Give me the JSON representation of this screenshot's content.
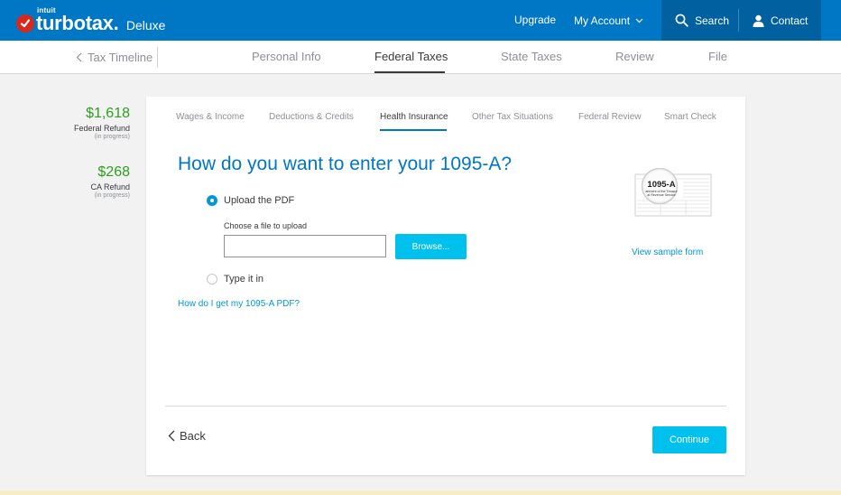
{
  "header": {
    "brand_small": "intuit",
    "brand": "turbotax.",
    "product": "Deluxe",
    "upgrade": "Upgrade",
    "my_account": "My Account",
    "search": "Search",
    "contact": "Contact"
  },
  "section_nav": {
    "timeline": "Tax Timeline",
    "items": [
      "Personal Info",
      "Federal Taxes",
      "State Taxes",
      "Review",
      "File"
    ],
    "active": "Federal Taxes"
  },
  "refunds": [
    {
      "amount": "$1,618",
      "label": "Federal Refund",
      "status": "(in progress)"
    },
    {
      "amount": "$268",
      "label": "CA Refund",
      "status": "(in progress)"
    }
  ],
  "subtabs": {
    "items": [
      "Wages & Income",
      "Deductions & Credits",
      "Health Insurance",
      "Other Tax Situations",
      "Federal Review",
      "Smart Check"
    ],
    "active": "Health Insurance"
  },
  "question": "How do you want to enter your 1095-A?",
  "options": [
    {
      "label": "Upload the PDF",
      "selected": true
    },
    {
      "label": "Type it in",
      "selected": false
    }
  ],
  "upload": {
    "label": "Choose a file to upload",
    "value": "",
    "browse": "Browse..."
  },
  "form_thumbnail": {
    "title": "1095-A",
    "line1": "artment of the Treasur",
    "line2": "al Revenue Service"
  },
  "links": {
    "help": "How do I get my 1095-A PDF?",
    "sample": "View sample form"
  },
  "footer": {
    "back": "Back",
    "continue": "Continue"
  },
  "colors": {
    "brand_blue": "#0077c5",
    "accent_cyan": "#00c1ee",
    "refund_green": "#2ca01c",
    "turbotax_red": "#d52b1e"
  }
}
